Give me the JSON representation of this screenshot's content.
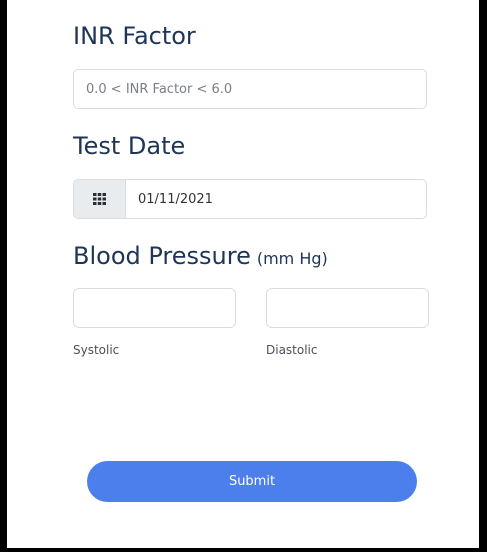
{
  "inr": {
    "label": "INR Factor",
    "placeholder": "0.0 < INR Factor < 6.0",
    "value": ""
  },
  "test_date": {
    "label": "Test Date",
    "value": "01/11/2021",
    "icon": "calendar-grid-icon"
  },
  "blood_pressure": {
    "label": "Blood Pressure",
    "unit": "(mm Hg)",
    "systolic_label": "Systolic",
    "diastolic_label": "Diastolic",
    "systolic_value": "",
    "diastolic_value": ""
  },
  "submit": {
    "label": "Submit",
    "color": "#4d7fec"
  }
}
